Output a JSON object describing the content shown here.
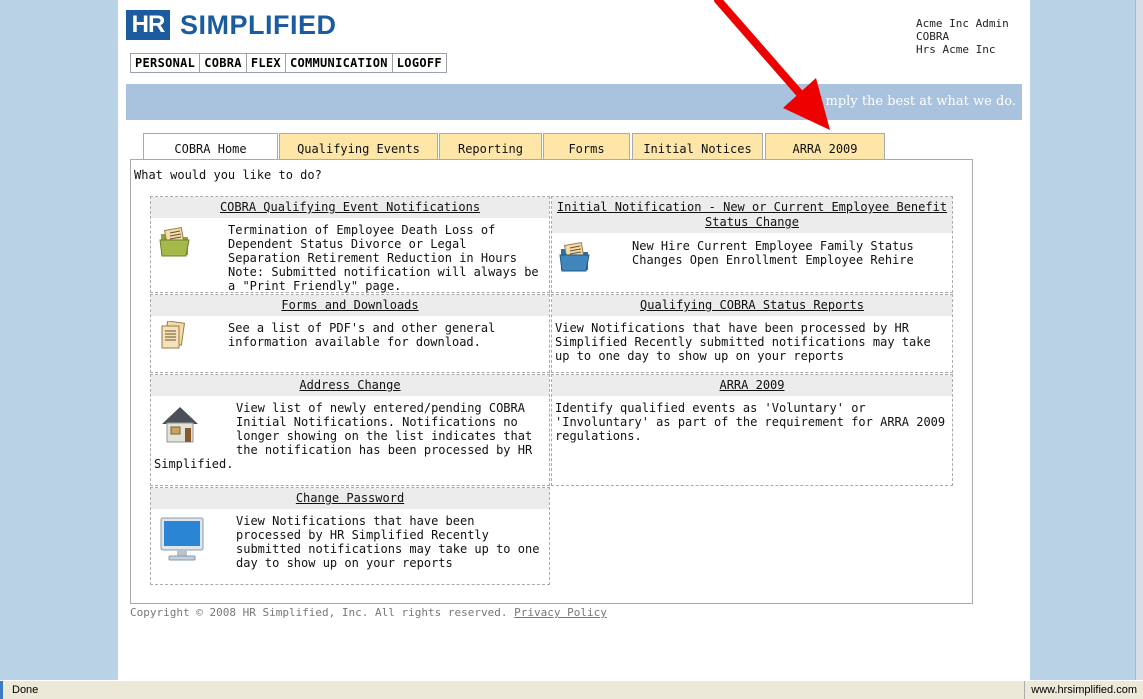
{
  "logo": {
    "box_text": "HR",
    "text": "SIMPLIFIED"
  },
  "topnav": [
    "PERSONAL",
    "COBRA",
    "FLEX",
    "COMMUNICATION",
    "LOGOFF"
  ],
  "account": {
    "line1": "Acme Inc Admin",
    "line2": "COBRA",
    "line3": "Hrs Acme Inc"
  },
  "banner_tagline": "mply the best at what we do.",
  "tabs": [
    "COBRA Home",
    "Qualifying Events",
    "Reporting",
    "Forms",
    "Initial Notices",
    "ARRA 2009"
  ],
  "active_tab": "COBRA Home",
  "prompt": "What would you like to do?",
  "cells": {
    "cobra_qe": {
      "title": "COBRA Qualifying Event Notifications",
      "body": "Termination of Employee Death Loss of Dependent Status Divorce or Legal Separation Retirement Reduction in Hours Note: Submitted notification will always be a \"Print Friendly\" page."
    },
    "initial_notification": {
      "title": "Initial Notification - New or Current Employee Benefit Status Change",
      "body": "New Hire Current Employee Family Status Changes Open Enrollment Employee Rehire"
    },
    "forms_downloads": {
      "title": "Forms and Downloads",
      "body": "See a list of PDF's and other general information available for download."
    },
    "status_reports": {
      "title": "Qualifying COBRA Status Reports",
      "body": "View Notifications that have been processed by HR Simplified Recently submitted notifications may take up to one day to show up on your reports"
    },
    "address_change": {
      "title": "Address Change",
      "body": "View list of newly entered/pending COBRA Initial Notifications. Notifications no longer showing on the list indicates that the notification has been processed by HR",
      "tail": "Simplified."
    },
    "arra": {
      "title": "ARRA 2009",
      "body": "Identify qualified events as 'Voluntary' or 'Involuntary' as part of the requirement for ARRA 2009 regulations."
    },
    "change_password": {
      "title": "Change Password",
      "body": "View Notifications that have been processed by HR Simplified Recently submitted notifications may take up to one day to show up on your reports"
    }
  },
  "copyright": {
    "text": "Copyright © 2008 HR Simplified, Inc. All rights reserved.",
    "link": "Privacy Policy"
  },
  "statusbar": {
    "left": "Done",
    "right": "www.hrsimplified.com"
  },
  "colors": {
    "brand_blue": "#1c5b9e",
    "banner": "#a9c2dd",
    "tab_bg": "#fde6a7",
    "annotation_arrow": "#ee0000"
  }
}
